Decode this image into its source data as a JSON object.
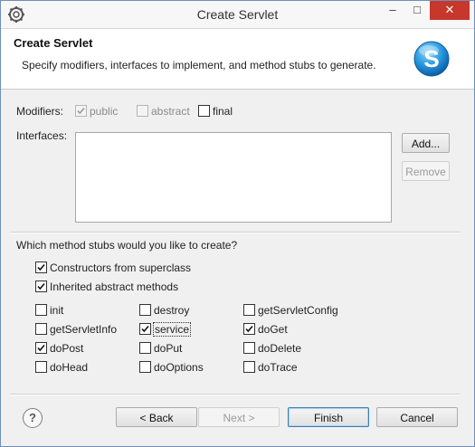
{
  "window": {
    "title": "Create Servlet",
    "minimize": "–",
    "maximize": "□",
    "close": "✕"
  },
  "header": {
    "title": "Create Servlet",
    "description": "Specify modifiers, interfaces to implement, and method stubs to generate.",
    "logo_letter": "S"
  },
  "modifiers": {
    "label": "Modifiers:",
    "options": [
      {
        "label": "public",
        "checked": true,
        "enabled": false
      },
      {
        "label": "abstract",
        "checked": false,
        "enabled": false
      },
      {
        "label": "final",
        "checked": false,
        "enabled": true
      }
    ]
  },
  "interfaces": {
    "label": "Interfaces:",
    "add_button": "Add...",
    "remove_button": "Remove",
    "items": []
  },
  "stubs": {
    "question": "Which method stubs would you like to create?",
    "constructors": {
      "label": "Constructors from superclass",
      "checked": true
    },
    "inherited": {
      "label": "Inherited abstract methods",
      "checked": true
    },
    "methods": [
      {
        "label": "init",
        "checked": false
      },
      {
        "label": "destroy",
        "checked": false
      },
      {
        "label": "getServletConfig",
        "checked": false
      },
      {
        "label": "getServletInfo",
        "checked": false
      },
      {
        "label": "service",
        "checked": true
      },
      {
        "label": "doGet",
        "checked": true
      },
      {
        "label": "doPost",
        "checked": true
      },
      {
        "label": "doPut",
        "checked": false
      },
      {
        "label": "doDelete",
        "checked": false
      },
      {
        "label": "doHead",
        "checked": false
      },
      {
        "label": "doOptions",
        "checked": false
      },
      {
        "label": "doTrace",
        "checked": false
      }
    ]
  },
  "footer": {
    "help": "?",
    "back_button": "< Back",
    "next_button": "Next >",
    "finish_button": "Finish",
    "cancel_button": "Cancel"
  }
}
